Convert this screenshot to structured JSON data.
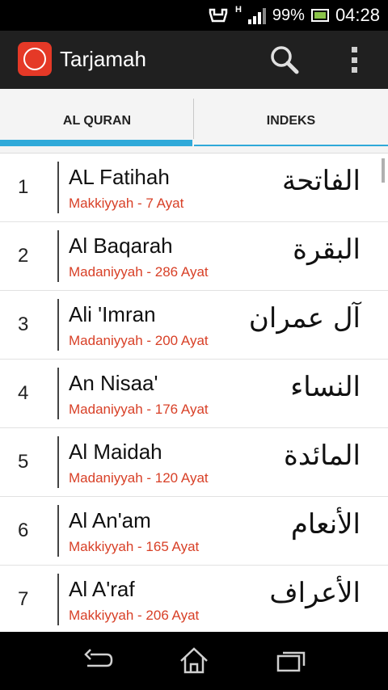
{
  "status_bar": {
    "battery": "99%",
    "time": "04:28",
    "network": "H"
  },
  "action_bar": {
    "title": "Tarjamah"
  },
  "tabs": [
    {
      "label": "AL QURAN",
      "active": true
    },
    {
      "label": "INDEKS",
      "active": false
    }
  ],
  "surahs": [
    {
      "number": "1",
      "name": "AL Fatihah",
      "info": "Makkiyyah - 7 Ayat",
      "arabic": "الفاتحة"
    },
    {
      "number": "2",
      "name": "Al Baqarah",
      "info": "Madaniyyah - 286 Ayat",
      "arabic": "البقرة"
    },
    {
      "number": "3",
      "name": "Ali 'Imran",
      "info": "Madaniyyah - 200 Ayat",
      "arabic": "آل عمران"
    },
    {
      "number": "4",
      "name": "An Nisaa'",
      "info": "Madaniyyah - 176 Ayat",
      "arabic": "النساء"
    },
    {
      "number": "5",
      "name": "Al Maidah",
      "info": "Madaniyyah - 120 Ayat",
      "arabic": "المائدة"
    },
    {
      "number": "6",
      "name": "Al An'am",
      "info": "Makkiyyah - 165 Ayat",
      "arabic": "الأنعام"
    },
    {
      "number": "7",
      "name": "Al A'raf",
      "info": "Makkiyyah - 206 Ayat",
      "arabic": "الأعراف"
    }
  ],
  "colors": {
    "accent": "#2fa9d9",
    "info_text": "#d84027",
    "action_bar": "#202020",
    "app_icon": "#e53927"
  }
}
